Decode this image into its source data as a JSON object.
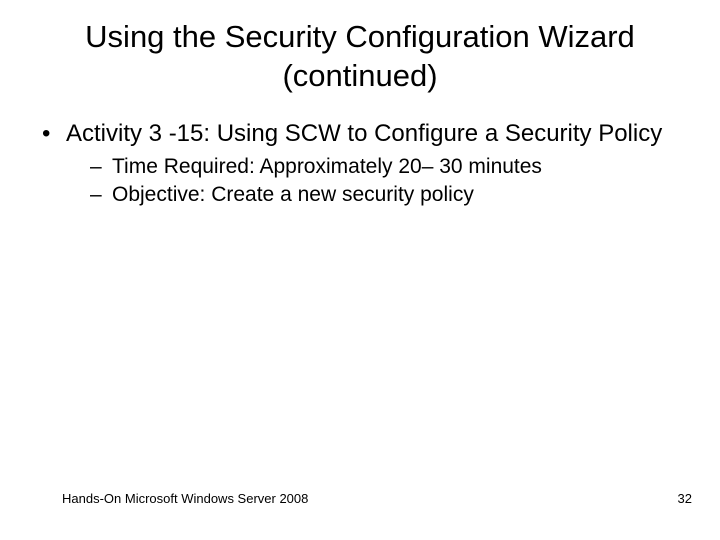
{
  "title": "Using the Security Configuration Wizard (continued)",
  "bullets": {
    "level1": [
      "Activity 3 -15: Using SCW to Configure a Security Policy"
    ],
    "level2": [
      "Time Required: Approximately 20– 30 minutes",
      "Objective: Create a new security policy"
    ]
  },
  "footer": {
    "source": "Hands-On Microsoft Windows Server 2008",
    "page": "32"
  }
}
